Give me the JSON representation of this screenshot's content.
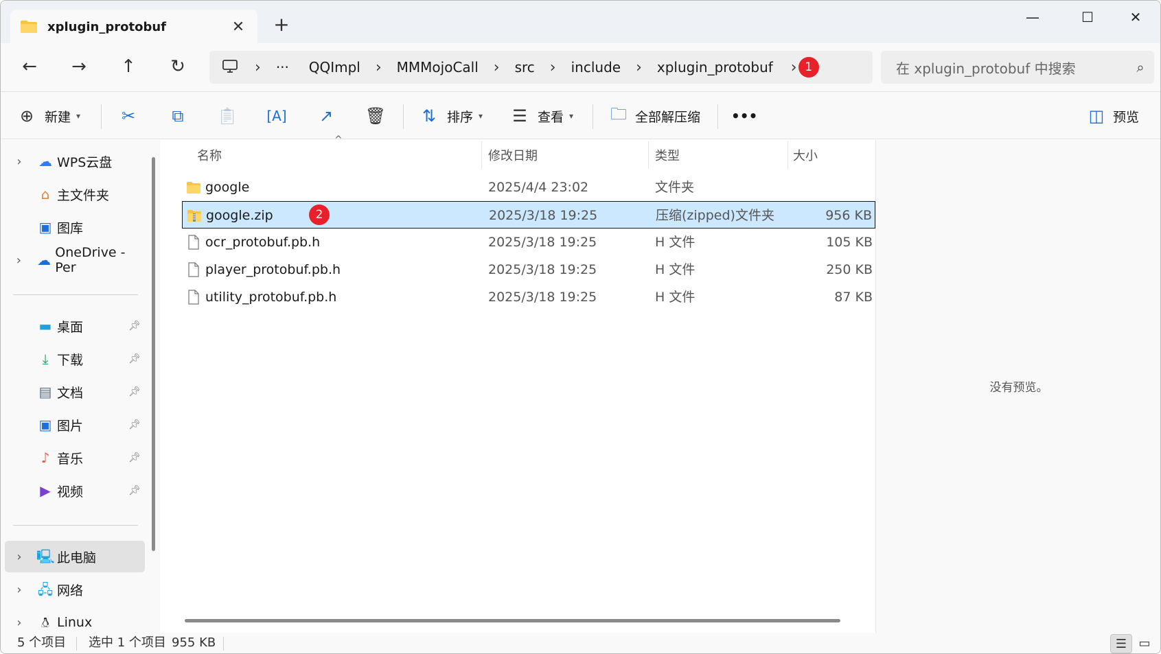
{
  "window": {
    "tab_title": "xplugin_protobuf",
    "minimize_glyph": "—",
    "maximize_glyph": "☐",
    "close_glyph": "✕"
  },
  "address": {
    "crumbs": [
      "···",
      "QQImpl",
      "MMMojoCall",
      "src",
      "include",
      "xplugin_protobuf"
    ],
    "badge": "1"
  },
  "search": {
    "placeholder": "在 xplugin_protobuf 中搜索"
  },
  "toolbar": {
    "new_label": "新建",
    "sort_label": "排序",
    "view_label": "查看",
    "extract_label": "全部解压缩",
    "more_label": "•••",
    "preview_label": "预览"
  },
  "sidebar": {
    "items": [
      {
        "label": "WPS云盘",
        "icon": "cloud-icon",
        "chevron": true,
        "pinned": false
      },
      {
        "label": "主文件夹",
        "icon": "home-icon",
        "chevron": false,
        "pinned": false
      },
      {
        "label": "图库",
        "icon": "gallery-icon",
        "chevron": false,
        "pinned": false
      },
      {
        "label": "OneDrive - Per",
        "icon": "onedrive-icon",
        "chevron": true,
        "pinned": false
      },
      {
        "label": "桌面",
        "icon": "desktop-icon",
        "chevron": false,
        "pinned": true
      },
      {
        "label": "下载",
        "icon": "download-icon",
        "chevron": false,
        "pinned": true
      },
      {
        "label": "文档",
        "icon": "documents-icon",
        "chevron": false,
        "pinned": true
      },
      {
        "label": "图片",
        "icon": "pictures-icon",
        "chevron": false,
        "pinned": true
      },
      {
        "label": "音乐",
        "icon": "music-icon",
        "chevron": false,
        "pinned": true
      },
      {
        "label": "视频",
        "icon": "videos-icon",
        "chevron": false,
        "pinned": true
      },
      {
        "label": "此电脑",
        "icon": "this-pc-icon",
        "chevron": true,
        "pinned": false
      },
      {
        "label": "网络",
        "icon": "network-icon",
        "chevron": true,
        "pinned": false
      },
      {
        "label": "Linux",
        "icon": "linux-icon",
        "chevron": true,
        "pinned": false
      }
    ]
  },
  "columns": {
    "name": "名称",
    "date": "修改日期",
    "type": "类型",
    "size": "大小"
  },
  "files": [
    {
      "name": "google",
      "date": "2025/4/4 23:02",
      "type": "文件夹",
      "size": "",
      "icon": "folder-icon"
    },
    {
      "name": "google.zip",
      "date": "2025/3/18 19:25",
      "type": "压缩(zipped)文件夹",
      "size": "956 KB",
      "icon": "zip-folder-icon",
      "selected": true,
      "badge": "2"
    },
    {
      "name": "ocr_protobuf.pb.h",
      "date": "2025/3/18 19:25",
      "type": "H 文件",
      "size": "105 KB",
      "icon": "file-icon"
    },
    {
      "name": "player_protobuf.pb.h",
      "date": "2025/3/18 19:25",
      "type": "H 文件",
      "size": "250 KB",
      "icon": "file-icon"
    },
    {
      "name": "utility_protobuf.pb.h",
      "date": "2025/3/18 19:25",
      "type": "H 文件",
      "size": "87 KB",
      "icon": "file-icon"
    }
  ],
  "preview": {
    "message": "没有预览。"
  },
  "status": {
    "count": "5 个项目",
    "selection": "选中 1 个项目",
    "selection_size": "955 KB"
  },
  "colors": {
    "selected_row": "#cce8ff",
    "accent": "#1f6fd6",
    "badge": "#e8202a",
    "folder": "#f6c543"
  }
}
